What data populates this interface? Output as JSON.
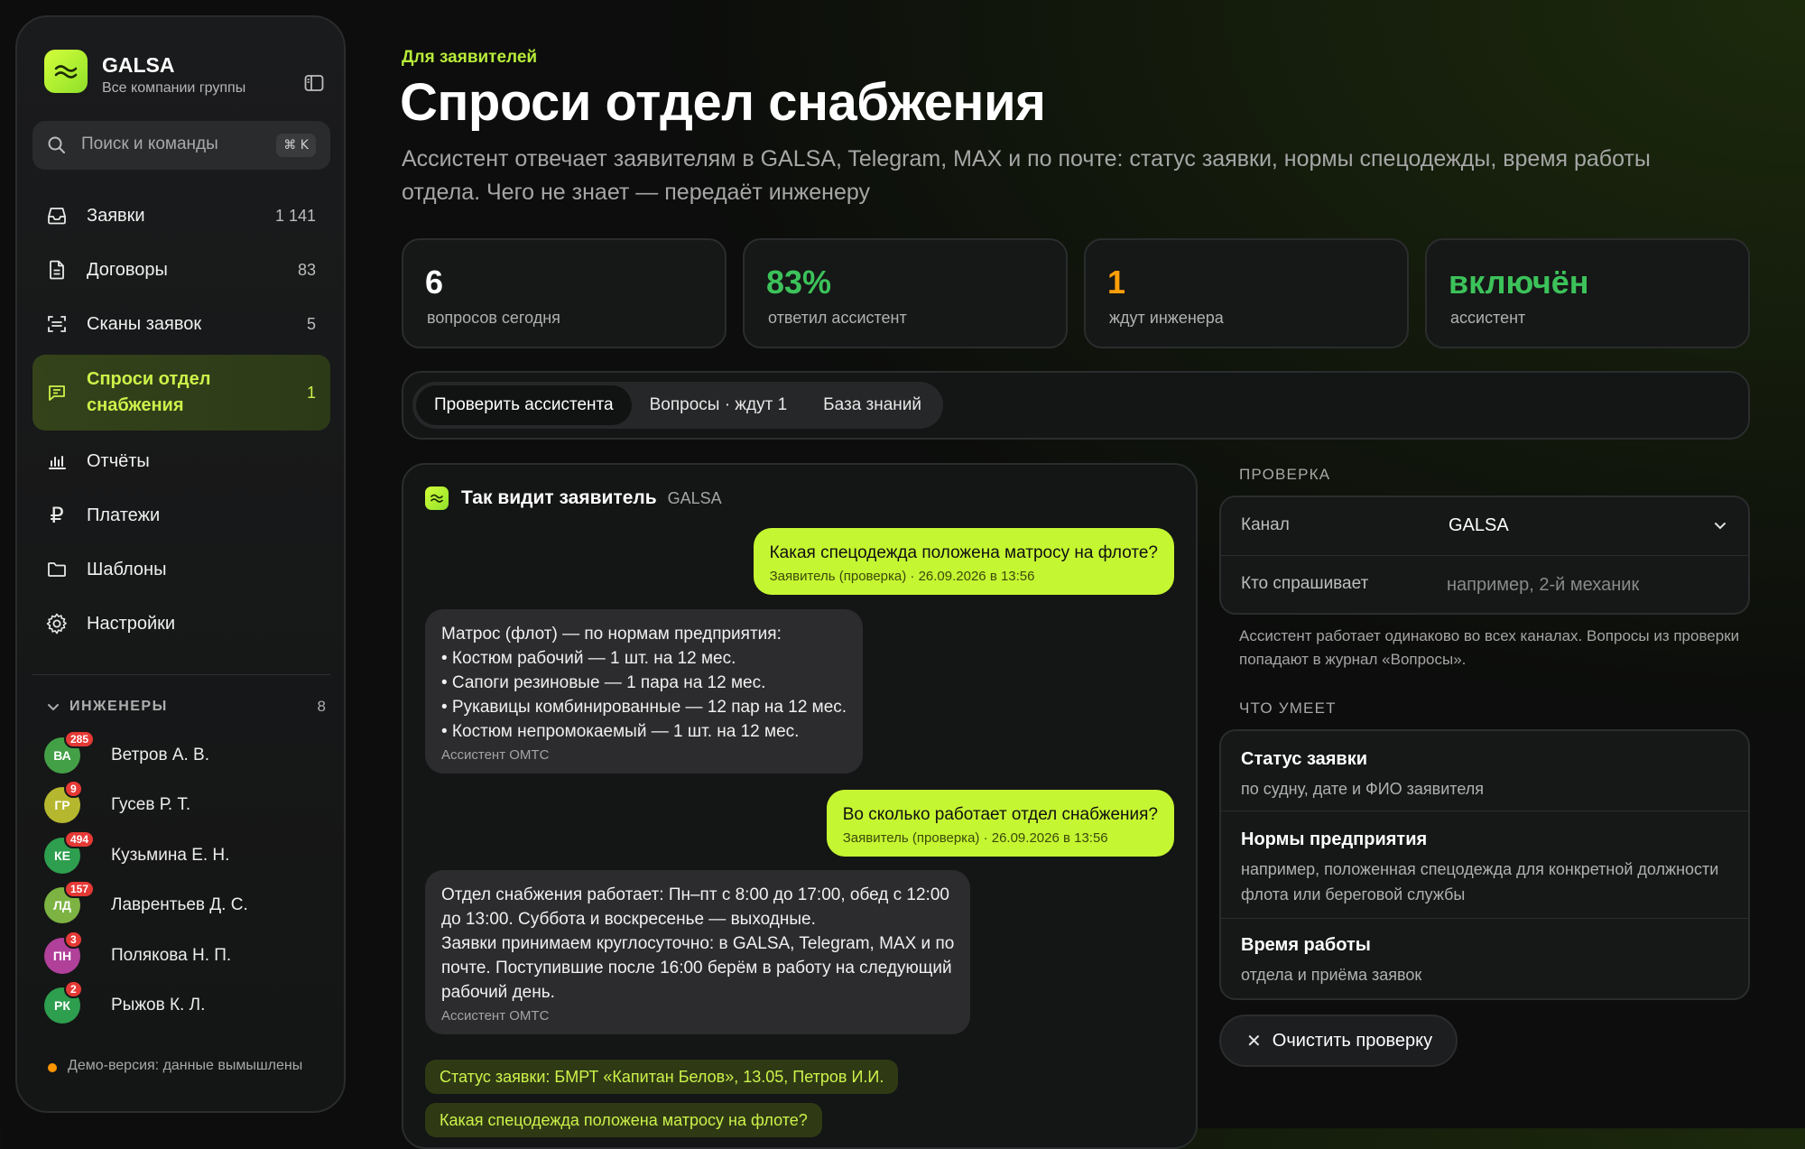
{
  "brand": {
    "name": "GALSA",
    "subtitle": "Все компании группы"
  },
  "search": {
    "placeholder": "Поиск и команды",
    "shortcut": "⌘ K"
  },
  "nav": [
    {
      "label": "Заявки",
      "count": "1 141",
      "icon": "inbox-icon"
    },
    {
      "label": "Договоры",
      "count": "83",
      "icon": "document-icon"
    },
    {
      "label": "Сканы заявок",
      "count": "5",
      "icon": "scan-icon"
    },
    {
      "label": "Спроси отдел снабжения",
      "count": "1",
      "icon": "chat-icon",
      "active": true
    },
    {
      "label": "Отчёты",
      "count": "",
      "icon": "bar-chart-icon"
    },
    {
      "label": "Платежи",
      "count": "",
      "icon": "ruble-icon"
    },
    {
      "label": "Шаблоны",
      "count": "",
      "icon": "folder-icon"
    },
    {
      "label": "Настройки",
      "count": "",
      "icon": "gear-icon"
    }
  ],
  "engineers": {
    "label": "ИНЖЕНЕРЫ",
    "count": "8",
    "items": [
      {
        "initials": "ВА",
        "name": "Ветров А. В.",
        "badge": "285",
        "color": "#43a047"
      },
      {
        "initials": "ГР",
        "name": "Гусев Р. Т.",
        "badge": "9",
        "color": "#b5b82e"
      },
      {
        "initials": "КЕ",
        "name": "Кузьмина Е. Н.",
        "badge": "494",
        "color": "#2e9e4f"
      },
      {
        "initials": "ЛД",
        "name": "Лаврентьев Д. С.",
        "badge": "157",
        "color": "#7cb342"
      },
      {
        "initials": "ПН",
        "name": "Полякова Н. П.",
        "badge": "3",
        "color": "#b0409a"
      },
      {
        "initials": "РК",
        "name": "Рыжов К. Л.",
        "badge": "2",
        "color": "#2e9e4f"
      }
    ]
  },
  "demo_note": "Демо-версия: данные вымышлены",
  "page": {
    "eyebrow": "Для заявителей",
    "title": "Спроси отдел снабжения",
    "subtitle": "Ассистент отвечает заявителям в GALSA, Telegram, MAX и по почте: статус заявки, нормы спецодежды, время работы отдела. Чего не знает — передаёт инженеру"
  },
  "stats": [
    {
      "value": "6",
      "label": "вопросов сегодня",
      "color": "#ffffff"
    },
    {
      "value": "83%",
      "label": "ответил ассистент",
      "color": "#3cc25a"
    },
    {
      "value": "1",
      "label": "ждут инженера",
      "color": "#ff9f0a"
    },
    {
      "value": "включён",
      "label": "ассистент",
      "color": "#3cc25a"
    }
  ],
  "tabs": [
    "Проверить ассистента",
    "Вопросы · ждут 1",
    "База знаний"
  ],
  "chat": {
    "title": "Так видит заявитель",
    "channel": "GALSA",
    "messages": [
      {
        "role": "user",
        "text": "Какая спецодежда положена матросу на флоте?",
        "meta": "Заявитель (проверка) · 26.09.2026 в 13:56"
      },
      {
        "role": "bot",
        "text": "Матрос (флот) — по нормам предприятия:\n• Костюм рабочий — 1 шт. на 12 мес.\n• Сапоги резиновые — 1 пара на 12 мес.\n• Рукавицы комбинированные — 12 пар на 12 мес.\n• Костюм непромокаемый — 1 шт. на 12 мес.",
        "meta": "Ассистент ОМТС"
      },
      {
        "role": "user",
        "text": "Во сколько работает отдел снабжения?",
        "meta": "Заявитель (проверка) · 26.09.2026 в 13:56"
      },
      {
        "role": "bot",
        "text": "Отдел снабжения работает: Пн–пт с 8:00 до 17:00, обед с 12:00\nдо 13:00. Суббота и воскресенье — выходные.\nЗаявки принимаем круглосуточно: в GALSA, Telegram, MAX и по\nпочте. Поступившие после 16:00 берём в работу на следующий\nрабочий день.",
        "meta": "Ассистент ОМТС"
      }
    ],
    "suggestions": [
      "Статус заявки: БМРТ «Капитан Белов», 13.05, Петров И.И.",
      "Какая спецодежда положена матросу на флоте?"
    ]
  },
  "check": {
    "section_label": "ПРОВЕРКА",
    "channel_label": "Канал",
    "channel_value": "GALSA",
    "asker_label": "Кто спрашивает",
    "asker_placeholder": "например, 2-й механик",
    "note": "Ассистент работает одинаково во всех каналах. Вопросы из проверки попадают в журнал «Вопросы»."
  },
  "skills": {
    "section_label": "ЧТО УМЕЕТ",
    "items": [
      {
        "title": "Статус заявки",
        "desc": "по судну, дате и ФИО заявителя"
      },
      {
        "title": "Нормы предприятия",
        "desc": "например, положенная спецодежда для конкретной должности флота или береговой службы"
      },
      {
        "title": "Время работы",
        "desc": "отдела и приёма заявок"
      }
    ]
  },
  "clear_button": "Очистить проверку",
  "colors": {
    "accent": "#c5f632",
    "background": "#0b0b0c",
    "panel": "#161717"
  }
}
